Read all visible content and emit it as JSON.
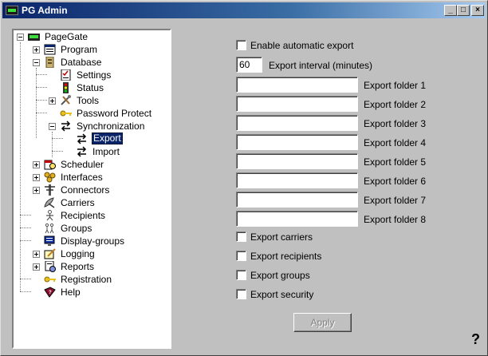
{
  "window": {
    "title": "PG Admin",
    "min": "_",
    "max": "□",
    "close": "×"
  },
  "tree": [
    {
      "label": "PageGate",
      "icon": "pager-icon"
    },
    {
      "label": "Program",
      "icon": "program-icon"
    },
    {
      "label": "Database",
      "icon": "database-icon"
    },
    {
      "label": "Settings",
      "icon": "settings-icon"
    },
    {
      "label": "Status",
      "icon": "status-icon"
    },
    {
      "label": "Tools",
      "icon": "tools-icon"
    },
    {
      "label": "Password Protect",
      "icon": "key-icon"
    },
    {
      "label": "Synchronization",
      "icon": "sync-icon"
    },
    {
      "label": "Export",
      "icon": "sync-icon",
      "selected": true
    },
    {
      "label": "Import",
      "icon": "sync-icon"
    },
    {
      "label": "Scheduler",
      "icon": "scheduler-icon"
    },
    {
      "label": "Interfaces",
      "icon": "interfaces-icon"
    },
    {
      "label": "Connectors",
      "icon": "connectors-icon"
    },
    {
      "label": "Carriers",
      "icon": "satellite-icon"
    },
    {
      "label": "Recipients",
      "icon": "person-icon"
    },
    {
      "label": "Groups",
      "icon": "group-icon"
    },
    {
      "label": "Display-groups",
      "icon": "display-icon"
    },
    {
      "label": "Logging",
      "icon": "logging-icon"
    },
    {
      "label": "Reports",
      "icon": "reports-icon"
    },
    {
      "label": "Registration",
      "icon": "key-icon"
    },
    {
      "label": "Help",
      "icon": "help-book-icon"
    }
  ],
  "export": {
    "enable_label": "Enable automatic export",
    "interval_value": "60",
    "interval_label": "Export interval (minutes)",
    "folders": [
      {
        "label": "Export folder 1",
        "value": ""
      },
      {
        "label": "Export folder 2",
        "value": ""
      },
      {
        "label": "Export folder 3",
        "value": ""
      },
      {
        "label": "Export folder 4",
        "value": ""
      },
      {
        "label": "Export folder 5",
        "value": ""
      },
      {
        "label": "Export folder 6",
        "value": ""
      },
      {
        "label": "Export folder 7",
        "value": ""
      },
      {
        "label": "Export folder 8",
        "value": ""
      }
    ],
    "options": [
      {
        "label": "Export carriers"
      },
      {
        "label": "Export recipients"
      },
      {
        "label": "Export groups"
      },
      {
        "label": "Export security"
      }
    ],
    "apply_label": "Apply"
  },
  "help_glyph": "?"
}
